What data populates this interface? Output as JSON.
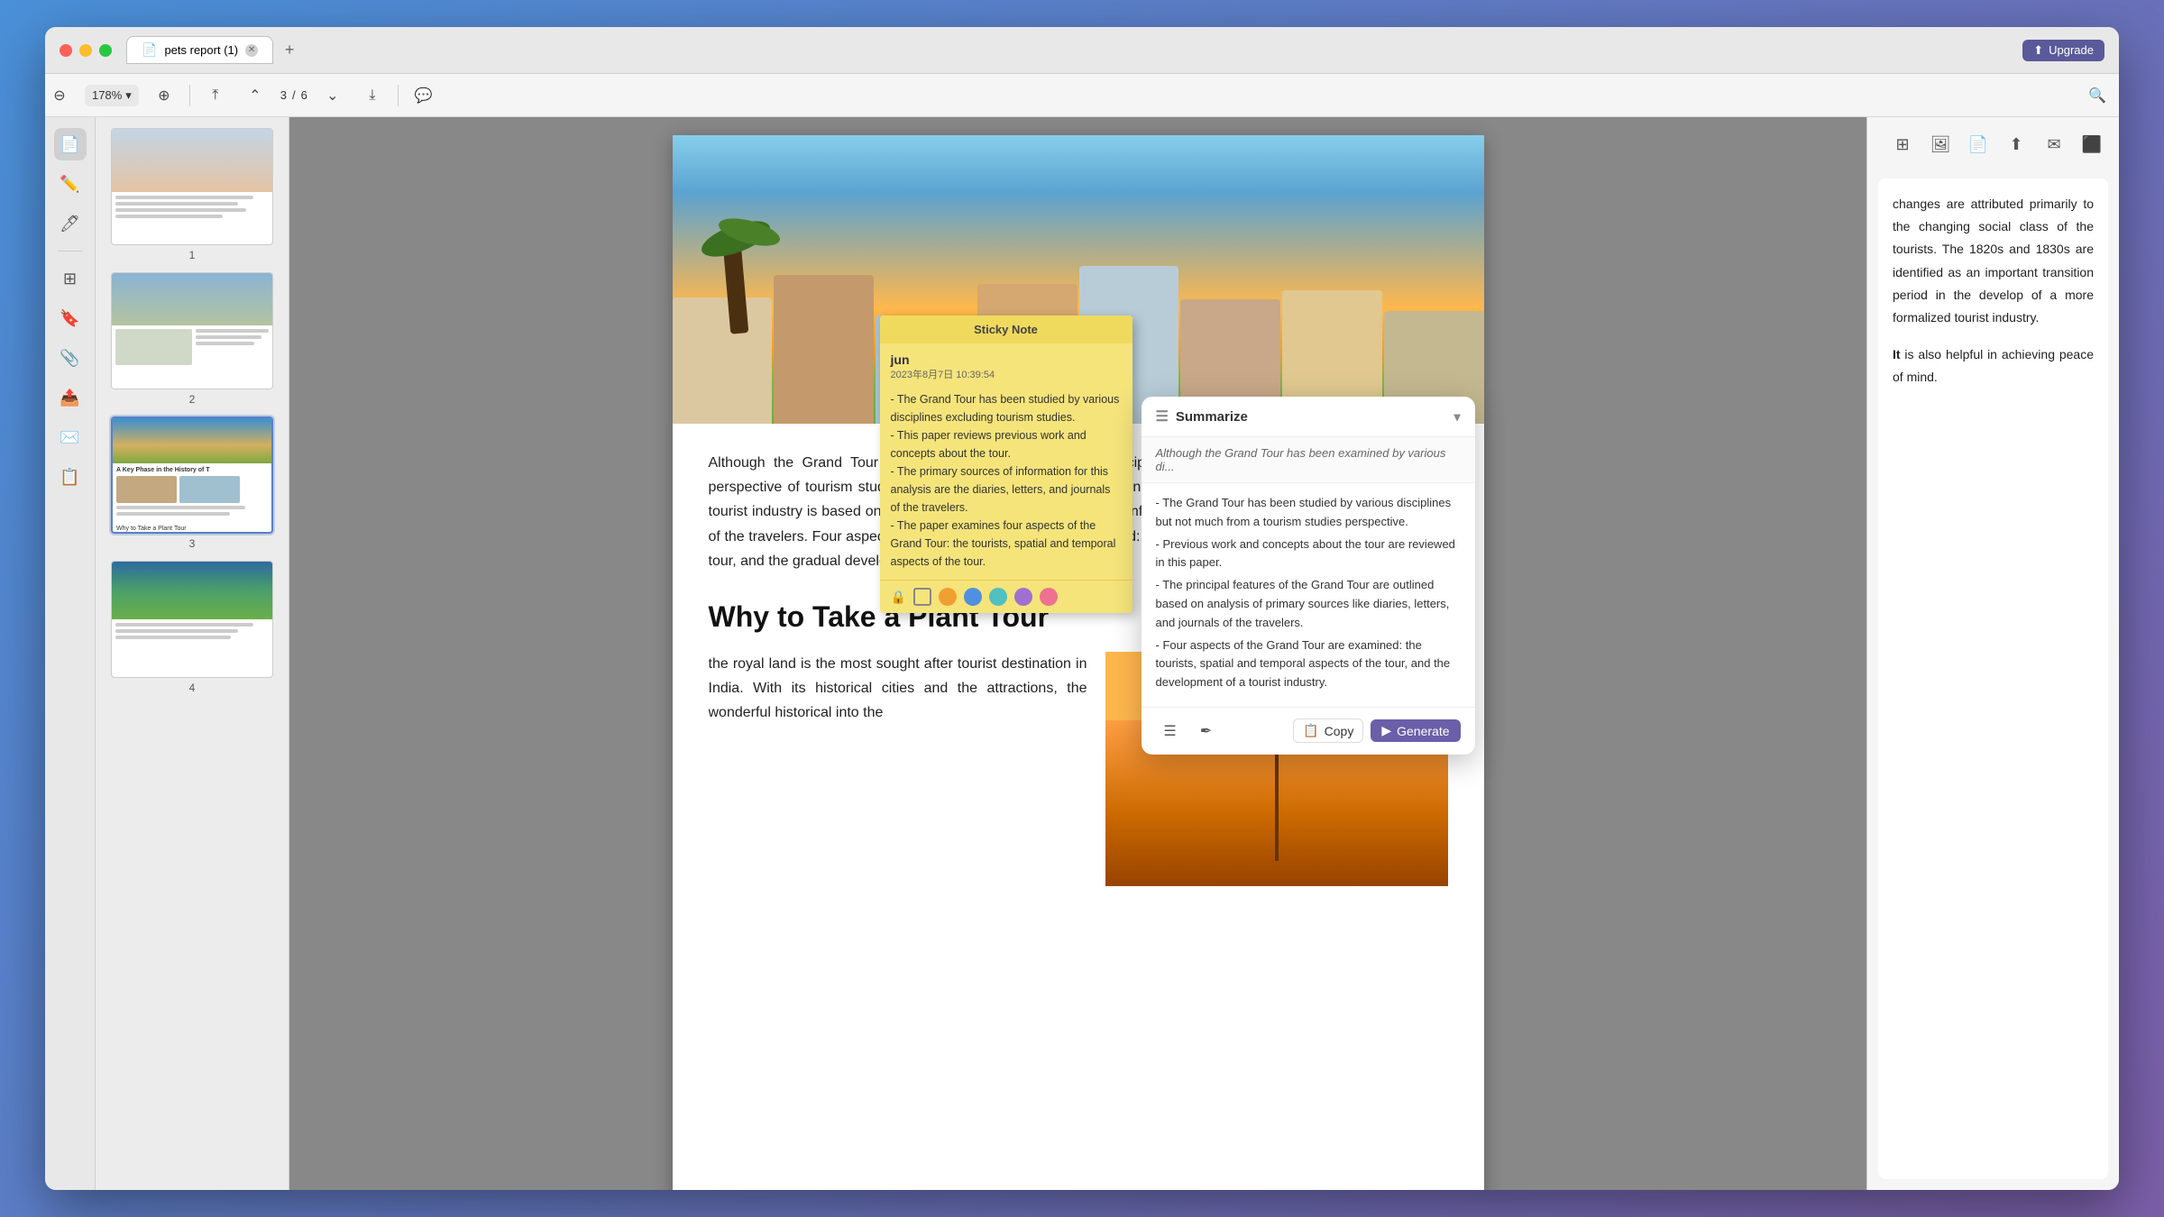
{
  "window": {
    "title": "pets report (1)",
    "upgrade_label": "Upgrade"
  },
  "toolbar": {
    "zoom": "178%",
    "page_current": "3",
    "page_total": "6"
  },
  "sticky_note": {
    "title": "Sticky Note",
    "author": "jun",
    "date": "2023年8月7日 10:39:54",
    "content": "- The Grand Tour has been studied by various disciplines excluding tourism studies.\n- This paper reviews previous work and concepts about the tour.\n- The primary sources of information for this analysis are the diaries, letters, and journals of the travelers.\n- The paper examines four aspects of the Grand Tour: the tourists, spatial and temporal aspects of the tour.",
    "colors": [
      "#888",
      "#fff",
      "#f0a030",
      "#5090e0",
      "#50c0c0",
      "#a070d0",
      "#f07090"
    ],
    "lock_icon": "🔒",
    "list_icon": "☰"
  },
  "summarize_popup": {
    "title": "Summarize",
    "dropdown_icon": "≡",
    "quote": "Although the Grand Tour has been examined by various di...",
    "bullet_1": "- The Grand Tour has been studied by various disciplines but not much from a tourism studies perspective.",
    "bullet_2": "- Previous work and concepts about the tour are reviewed in this paper.",
    "bullet_3": "- The principal features of the Grand Tour are outlined based on analysis of primary sources like diaries, letters, and journals of the travelers.",
    "bullet_4": "- Four aspects of the Grand Tour are examined: the tourists, spatial and temporal aspects of the tour, and the development of a tourist industry.",
    "copy_label": "Copy",
    "generate_label": "Generate"
  },
  "doc": {
    "section_title": "Why to Take a Plant Tour",
    "para1": "Although the Grand Tour has been examined by various disciplines, it has rarely been examined from the perspective of tourism studies. A review of previous work and concepts about the tour and the development of a tourist industry is based on an analysis of the primary sources of information for this analysis are the diaries, letters of the travelers. Four aspects of the Grand Tour are then examined: the tourists, spatial and temporal aspects of the tour, and the gradual development of a tourist industry.",
    "para2": "the royal land is the most sought after tourist destination in India. With its historical cities and the attractions, the wonderful historical into the",
    "right_text_1": "changes are attributed primarily to the changing social class of the tourists. The 1820s and 1830s are identified as an important transition period in the develop of a more formalized tourist industry.",
    "right_text_2": "It is also helpful in achieving peace of mind."
  },
  "sidebar": {
    "icons": [
      "doc",
      "text-tool",
      "divider",
      "thumbnails",
      "pages"
    ],
    "page_labels": [
      "1",
      "2",
      "3",
      "4"
    ]
  }
}
